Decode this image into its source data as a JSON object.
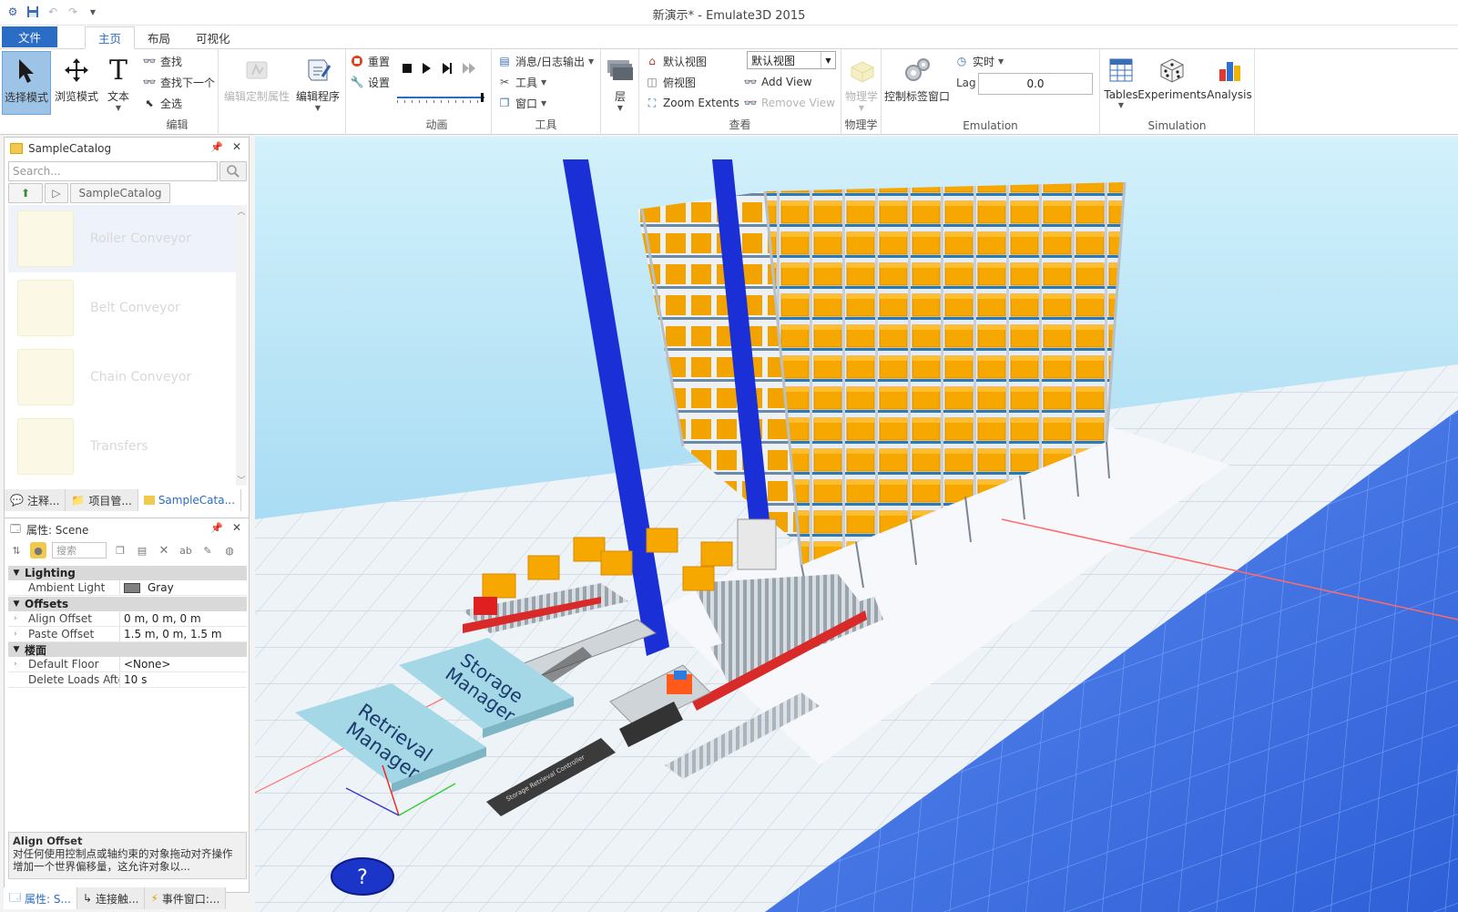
{
  "window": {
    "title": "新演示* - Emulate3D 2015"
  },
  "ribbon_tabs": [
    {
      "label": "文件"
    },
    {
      "label": "主页"
    },
    {
      "label": "布局"
    },
    {
      "label": "可视化"
    }
  ],
  "ribbon": {
    "edit": {
      "select_mode": "选择模式",
      "browse_mode": "浏览模式",
      "text": "文本",
      "find": "查找",
      "find_next": "查找下一个",
      "select_all": "全选",
      "label": "编辑"
    },
    "edit_props": {
      "edit_custom": "编辑定制属性",
      "edit_program": "编辑程序"
    },
    "animation": {
      "reset": "重置",
      "settings": "设置",
      "label": "动画"
    },
    "tools": {
      "messages": "消息/日志输出",
      "tools": "工具",
      "window": "窗口",
      "label": "工具"
    },
    "layers": {
      "label": "层"
    },
    "view": {
      "default_view": "默认视图",
      "top_view": "俯视图",
      "zoom_extents": "Zoom Extents",
      "combo_value": "默认视图",
      "add_view": "Add View",
      "remove_view": "Remove View",
      "label": "查看"
    },
    "physics": {
      "button": "物理学",
      "label": "物理学"
    },
    "emulation": {
      "control_tags": "控制标签窗口",
      "realtime": "实时",
      "lag_label": "Lag",
      "lag_value": "0.0",
      "label": "Emulation"
    },
    "simulation": {
      "tables": "Tables",
      "experiments": "Experiments",
      "analysis": "Analysis",
      "label": "Simulation"
    }
  },
  "catalog_panel": {
    "title": "SampleCatalog",
    "search_placeholder": "Search...",
    "breadcrumb": "SampleCatalog",
    "items": [
      {
        "label": "Roller Conveyor"
      },
      {
        "label": "Belt Conveyor"
      },
      {
        "label": "Chain Conveyor"
      },
      {
        "label": "Transfers"
      }
    ],
    "tabs": [
      {
        "label": "注释..."
      },
      {
        "label": "项目管..."
      },
      {
        "label": "SampleCata..."
      }
    ]
  },
  "properties_panel": {
    "title": "属性: Scene",
    "search_placeholder": "搜索",
    "categories": [
      {
        "name": "Lighting",
        "rows": [
          {
            "key": "Ambient Light",
            "value": "Gray"
          }
        ]
      },
      {
        "name": "Offsets",
        "rows": [
          {
            "key": "Align Offset",
            "value": "0 m, 0 m, 0 m"
          },
          {
            "key": "Paste Offset",
            "value": "1.5 m, 0 m, 1.5 m"
          }
        ]
      },
      {
        "name": "楼面",
        "rows": [
          {
            "key": "Default Floor",
            "value": "<None>"
          },
          {
            "key": "Delete Loads After",
            "value": "10 s"
          }
        ]
      }
    ],
    "description": {
      "title": "Align Offset",
      "text": "对任何使用控制点或轴约束的对象拖动对齐操作增加一个世界偏移量，这允许对象以..."
    },
    "tabs": [
      {
        "label": "属性: S..."
      },
      {
        "label": "连接触..."
      },
      {
        "label": "事件窗口:..."
      }
    ]
  },
  "scene": {
    "storage_sign": "Storage\nManager",
    "retrieval_sign": "Retrieval\nManager",
    "controller_label": "Storage Retrieval Controller",
    "help_glyph": "?"
  },
  "colors": {
    "accent": "#2b6cc4",
    "crane_blue": "#1a2fd6",
    "tote_orange": "#f5a300",
    "floor_blue": "#3b6fe0"
  }
}
